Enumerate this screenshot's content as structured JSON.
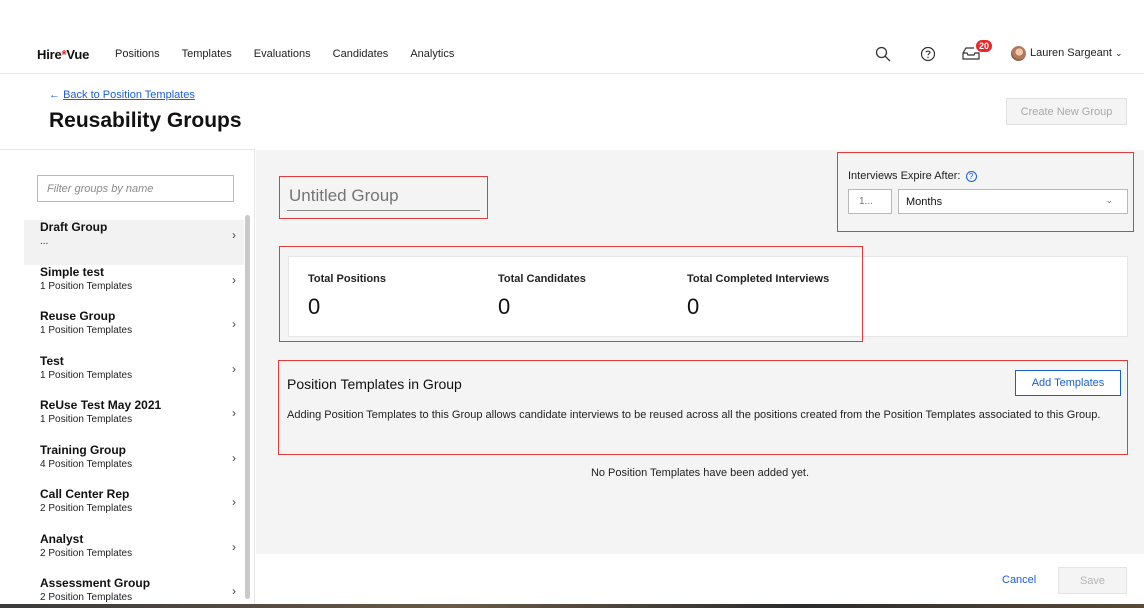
{
  "nav": {
    "logo_text_a": "Hire",
    "logo_star": "*",
    "logo_text_b": "Vue",
    "links": [
      "Positions",
      "Templates",
      "Evaluations",
      "Candidates",
      "Analytics"
    ],
    "badge_count": "20",
    "user_name": "Lauren Sargeant",
    "user_chevron": "⌄",
    "icons": [
      "search-icon",
      "help-icon",
      "inbox-icon",
      "avatar"
    ]
  },
  "header": {
    "back_arrow": "←",
    "back_label": "Back to Position Templates",
    "title": "Reusability Groups",
    "create_button": "Create New Group"
  },
  "sidebar": {
    "filter_placeholder": "Filter groups by name",
    "items": [
      {
        "name": "Draft Group",
        "sub": "...",
        "active": true
      },
      {
        "name": "Simple test",
        "sub": "1 Position Templates"
      },
      {
        "name": "Reuse Group",
        "sub": "1 Position Templates"
      },
      {
        "name": "Test",
        "sub": "1 Position Templates"
      },
      {
        "name": "ReUse Test May 2021",
        "sub": "1 Position Templates"
      },
      {
        "name": "Training Group",
        "sub": "4 Position Templates"
      },
      {
        "name": "Call Center Rep",
        "sub": "2 Position Templates"
      },
      {
        "name": "Analyst",
        "sub": "2 Position Templates"
      },
      {
        "name": "Assessment Group",
        "sub": "2 Position Templates"
      }
    ],
    "chevron": "›"
  },
  "group": {
    "name_placeholder": "Untitled Group",
    "expire_label": "Interviews Expire After:",
    "expire_help": "?",
    "expire_value_placeholder": "1...",
    "expire_unit": "Months",
    "expire_chevron": "⌄"
  },
  "stats": {
    "positions_label": "Total Positions",
    "positions_value": "0",
    "candidates_label": "Total Candidates",
    "candidates_value": "0",
    "interviews_label": "Total Completed Interviews",
    "interviews_value": "0"
  },
  "templates": {
    "title": "Position Templates in Group",
    "add_button": "Add Templates",
    "description": "Adding Position Templates to this Group allows candidate interviews to be reused across all the positions created from the Position Templates associated to this Group.",
    "empty_message": "No Position Templates have been added yet."
  },
  "footer": {
    "cancel": "Cancel",
    "save": "Save"
  }
}
